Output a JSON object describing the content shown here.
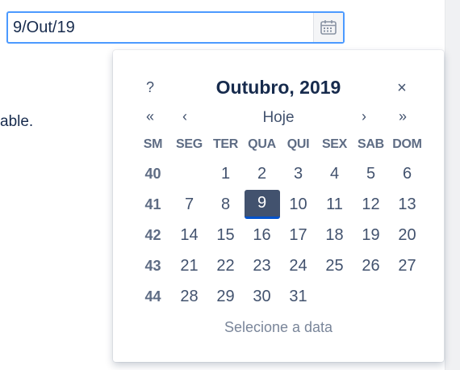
{
  "date_input": {
    "value": "9/Out/19"
  },
  "background_text": "able.",
  "calendar": {
    "help_label": "?",
    "month_title": "Outubro, 2019",
    "close_label": "×",
    "nav": {
      "prev_year": "«",
      "prev_month": "‹",
      "today": "Hoje",
      "next_month": "›",
      "next_year": "»"
    },
    "weekday_headers": [
      "SM",
      "SEG",
      "TER",
      "QUA",
      "QUI",
      "SEX",
      "SAB",
      "DOM"
    ],
    "weeks": [
      {
        "week": "40",
        "days": [
          "",
          "1",
          "2",
          "3",
          "4",
          "5",
          "6"
        ]
      },
      {
        "week": "41",
        "days": [
          "7",
          "8",
          "9",
          "10",
          "11",
          "12",
          "13"
        ]
      },
      {
        "week": "42",
        "days": [
          "14",
          "15",
          "16",
          "17",
          "18",
          "19",
          "20"
        ]
      },
      {
        "week": "43",
        "days": [
          "21",
          "22",
          "23",
          "24",
          "25",
          "26",
          "27"
        ]
      },
      {
        "week": "44",
        "days": [
          "28",
          "29",
          "30",
          "31",
          "",
          "",
          ""
        ]
      }
    ],
    "selected_day": "9",
    "footer": "Selecione a data"
  },
  "colors": {
    "input_focus_border": "#4c9aff",
    "selected_bg": "#42526e",
    "selected_underline": "#0052cc",
    "text_primary": "#172b4d",
    "text_secondary": "#5e6c84",
    "footer_text": "#7a869a"
  },
  "icons": {
    "calendar_button": "calendar-icon"
  }
}
